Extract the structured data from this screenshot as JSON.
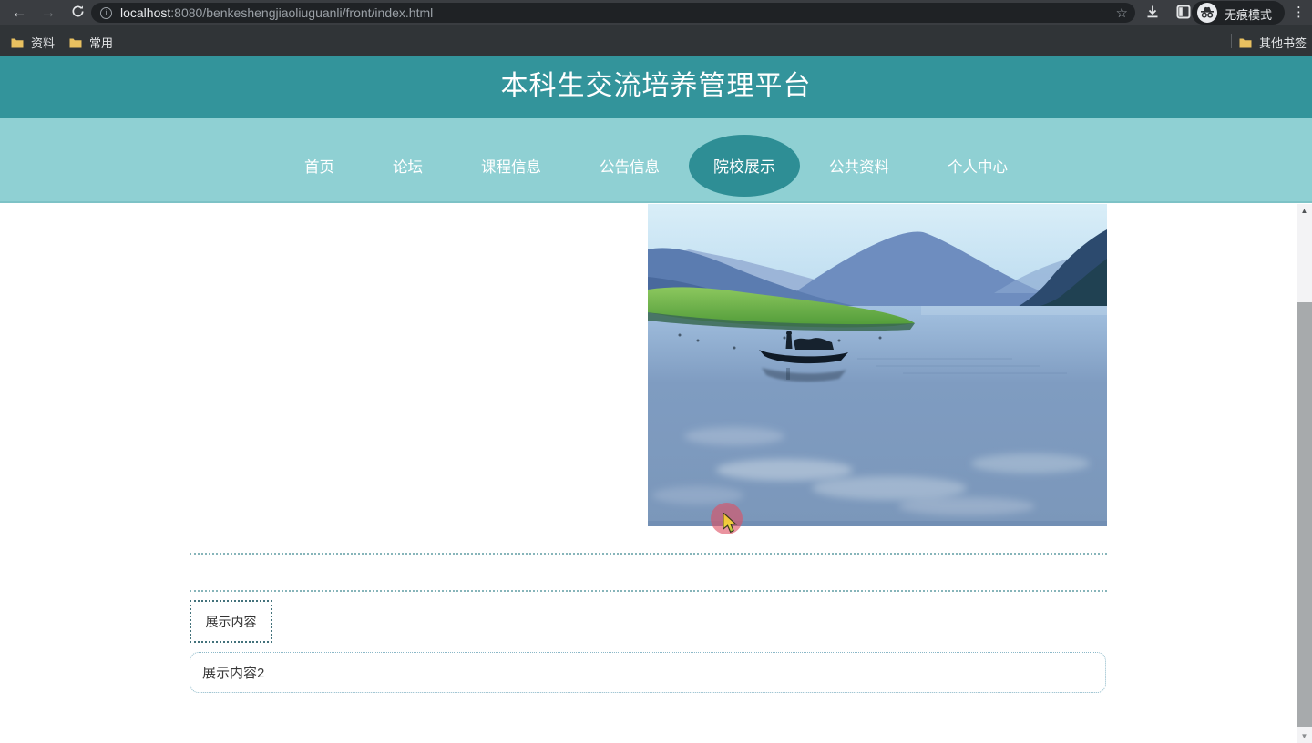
{
  "browser": {
    "url": {
      "host": "localhost",
      "rest": ":8080/benkeshengjiaoliuguanli/front/index.html"
    },
    "incognito_label": "无痕模式",
    "bookmarks": {
      "items": [
        {
          "label": "资料"
        },
        {
          "label": "常用"
        }
      ],
      "other_label": "其他书签"
    }
  },
  "icons": {
    "back": "←",
    "forward": "→",
    "star": "☆",
    "menu": "⋮",
    "info": "i",
    "up_arrow": "▲",
    "down_arrow": "▼"
  },
  "header": {
    "title": "本科生交流培养管理平台"
  },
  "nav": {
    "items": [
      {
        "label": "首页",
        "active": false
      },
      {
        "label": "论坛",
        "active": false
      },
      {
        "label": "课程信息",
        "active": false
      },
      {
        "label": "公告信息",
        "active": false
      },
      {
        "label": "院校展示",
        "active": true
      },
      {
        "label": "公共资料",
        "active": false
      },
      {
        "label": "个人中心",
        "active": false
      }
    ]
  },
  "content": {
    "photo_alt": "lake-landscape-photo",
    "box1_text": "展示内容",
    "box2_text": "展示内容2"
  },
  "colors": {
    "header_teal": "#33949b",
    "nav_teal": "#8fd0d3",
    "active_nav_teal": "#2e8e95",
    "divider_teal": "#5f9da3",
    "click_halo_red": "#dd5064",
    "toolbar_dark": "#3a3d41",
    "bookmarks_dark": "#303437"
  }
}
